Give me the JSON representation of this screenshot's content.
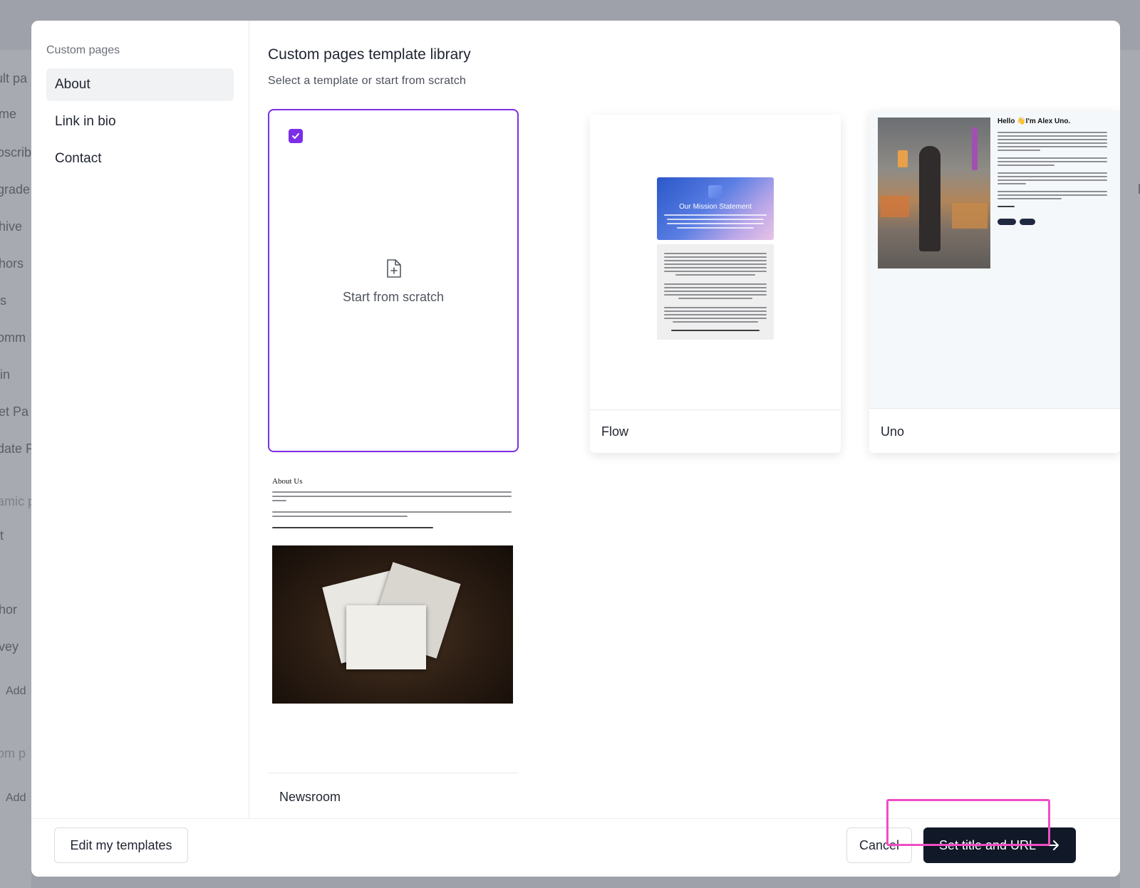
{
  "background": {
    "left_items": [
      "ult pa",
      "me",
      "oscrib",
      "grade",
      "hive",
      "hors",
      "s",
      "omm",
      "in",
      "et Pa",
      "date P",
      "amic p",
      "t",
      "hor",
      "vey",
      "Add",
      "om p",
      "Add"
    ],
    "right_items": [
      "loc"
    ]
  },
  "sidebar": {
    "title": "Custom pages",
    "items": [
      {
        "label": "About",
        "active": true
      },
      {
        "label": "Link in bio",
        "active": false
      },
      {
        "label": "Contact",
        "active": false
      }
    ]
  },
  "main": {
    "title": "Custom pages template library",
    "subtitle": "Select a template or start from scratch",
    "templates": {
      "scratch": {
        "label": "Start from scratch",
        "selected": true,
        "icon": "file-plus-icon"
      },
      "flow": {
        "label": "Flow",
        "preview_title": "Our Mission Statement"
      },
      "uno": {
        "label": "Uno",
        "preview_title": "Hello 👋I'm Alex Uno."
      },
      "newsroom": {
        "label": "Newsroom",
        "preview_title": "About Us"
      }
    }
  },
  "footer": {
    "edit_label": "Edit my templates",
    "cancel_label": "Cancel",
    "primary_label": "Set title and URL",
    "primary_icon": "arrow-right-icon"
  },
  "colors": {
    "accent": "#7c2ee6",
    "primary_button": "#111827",
    "highlight": "#f04dc4"
  }
}
